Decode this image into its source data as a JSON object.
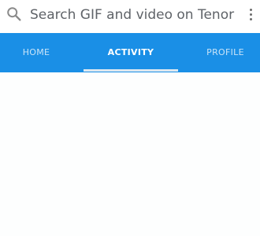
{
  "search": {
    "placeholder": "Search GIF and video on Tenor",
    "icon": "search-icon",
    "menu_icon": "more-vert-icon"
  },
  "tabs": [
    {
      "label": "HOME",
      "selected": false
    },
    {
      "label": "ACTIVITY",
      "selected": true
    },
    {
      "label": "PROFILE",
      "selected": false
    }
  ],
  "colors": {
    "tab_bar": "#1a8fe6",
    "tab_selected_text": "#ffffff",
    "tab_unselected_text": "#c9e4f8",
    "search_text": "#5f6368"
  }
}
